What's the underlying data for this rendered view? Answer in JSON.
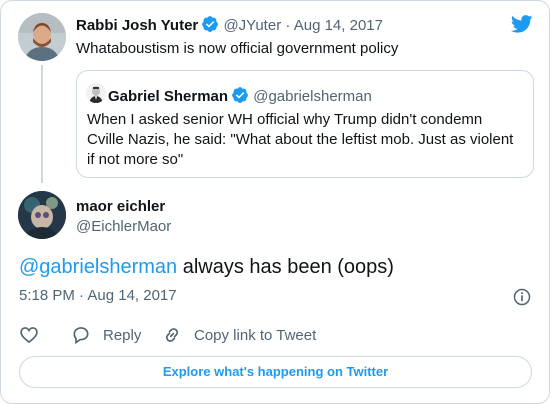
{
  "tweet_parent": {
    "author_name": "Rabbi Josh Yuter",
    "handle": "@JYuter",
    "separator": "·",
    "date": "Aug 14, 2017",
    "text": "Whataboustism is now official government policy",
    "quote": {
      "author_name": "Gabriel Sherman",
      "handle": "@gabrielsherman",
      "text": "When I asked senior WH official why Trump didn't condemn Cville Nazis, he said: \"What about the leftist mob. Just as violent if not more so\""
    }
  },
  "tweet_main": {
    "author_name": "maor eichler",
    "handle": "@EichlerMaor",
    "mention": "@gabrielsherman",
    "text": " always has been (oops)",
    "timestamp": "5:18 PM · Aug 14, 2017"
  },
  "actions": {
    "reply_label": "Reply",
    "copy_label": "Copy link to Tweet"
  },
  "explore_label": "Explore what's happening on Twitter",
  "colors": {
    "accent": "#1d9bf0",
    "muted": "#536471",
    "border": "#cfd9de",
    "heart": "#536471"
  },
  "icons": [
    "twitter-bird-icon",
    "verified-badge-icon",
    "info-icon",
    "heart-icon",
    "reply-icon",
    "link-icon"
  ]
}
